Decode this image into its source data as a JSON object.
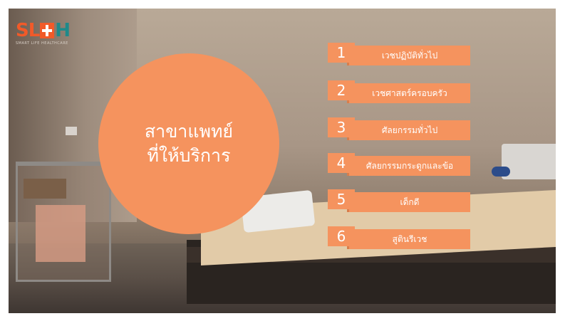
{
  "brand": {
    "logo_text_left": "SL",
    "logo_text_right": "H",
    "tagline": "SMART LIFE HEALTHCARE",
    "primary_color": "#f5935e",
    "logo_orange": "#f15a29",
    "logo_teal": "#1f8a8a"
  },
  "circle": {
    "line1": "สาขาแพทย์",
    "line2": "ที่ให้บริการ"
  },
  "services": [
    {
      "number": "1",
      "label": "เวชปฏิบัติทั่วไป"
    },
    {
      "number": "2",
      "label": "เวชศาสตร์ครอบครัว"
    },
    {
      "number": "3",
      "label": "ศัลยกรรมทั่วไป"
    },
    {
      "number": "4",
      "label": "ศัลยกรรมกระดูกและข้อ"
    },
    {
      "number": "5",
      "label": "เด็กดี"
    },
    {
      "number": "6",
      "label": "สูตินรีเวช"
    }
  ]
}
